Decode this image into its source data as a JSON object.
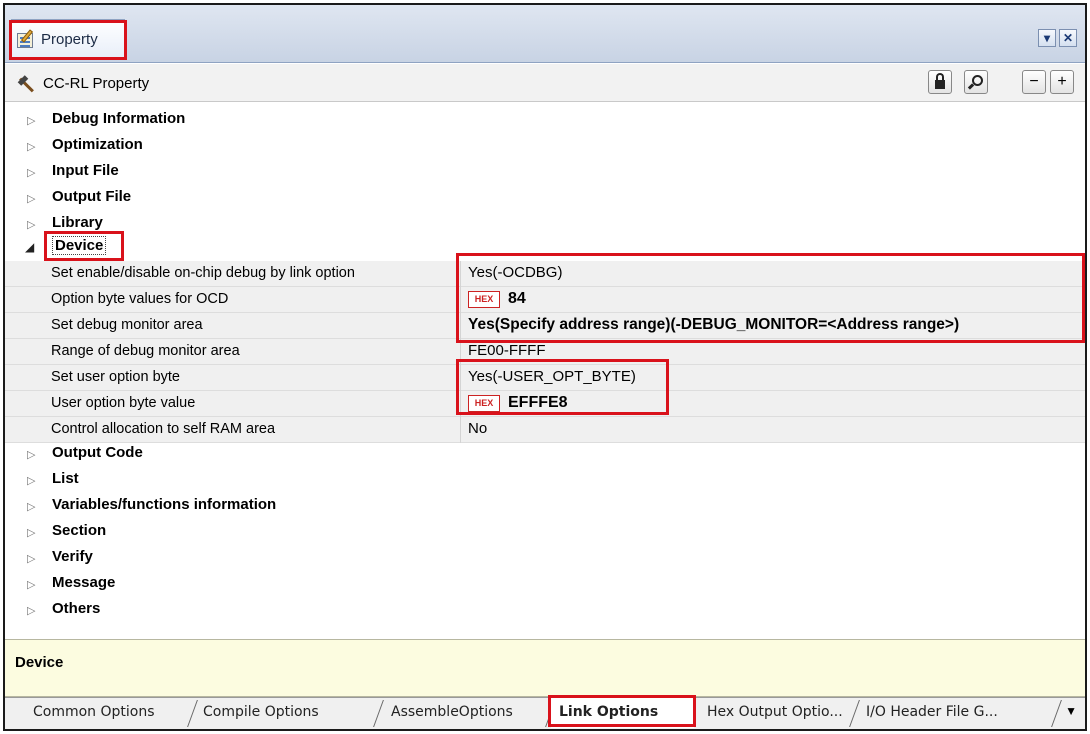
{
  "titlebar": {
    "tab_label": "Property",
    "dropdown_glyph": "▾",
    "close_glyph": "✕"
  },
  "header": {
    "title": "CC-RL Property",
    "minus_glyph": "−",
    "plus_glyph": "+"
  },
  "categories_before": [
    {
      "label": "Debug Information"
    },
    {
      "label": "Optimization"
    },
    {
      "label": "Input File"
    },
    {
      "label": "Output File"
    },
    {
      "label": "Library"
    }
  ],
  "device": {
    "label": "Device",
    "properties": [
      {
        "name": "Set enable/disable on-chip debug by link option",
        "value": "Yes(-OCDBG)"
      },
      {
        "name": "Option byte values for OCD",
        "value": "84",
        "hex": true
      },
      {
        "name": "Set debug monitor area",
        "value": "Yes(Specify address range)(-DEBUG_MONITOR=<Address range>)",
        "bold": true
      },
      {
        "name": "Range of debug monitor area",
        "value": "FE00-FFFF"
      },
      {
        "name": "Set user option byte",
        "value": "Yes(-USER_OPT_BYTE)"
      },
      {
        "name": "User option byte value",
        "value": "EFFFE8",
        "hex": true
      },
      {
        "name": "Control allocation to self RAM area",
        "value": "No"
      }
    ]
  },
  "hex_badge": "HEX",
  "categories_after": [
    {
      "label": "Output Code"
    },
    {
      "label": "List"
    },
    {
      "label": "Variables/functions information"
    },
    {
      "label": "Section"
    },
    {
      "label": "Verify"
    },
    {
      "label": "Message"
    },
    {
      "label": "Others"
    }
  ],
  "description": {
    "title": "Device"
  },
  "tabs": [
    {
      "label": "Common Options"
    },
    {
      "label": "Compile Options"
    },
    {
      "label": "AssembleOptions"
    },
    {
      "label": "Link Options"
    },
    {
      "label": "Hex Output Optio..."
    },
    {
      "label": "I/O Header File G..."
    }
  ],
  "tab_menu_glyph": "▼",
  "collapsed_arrow": "▷",
  "expanded_arrow": "◢"
}
